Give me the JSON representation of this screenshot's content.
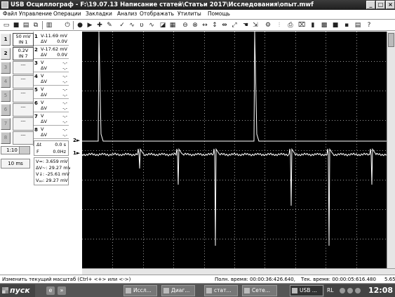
{
  "window": {
    "title": "USB Осциллограф - F:\\19.07.13 Написание статей\\Статьи 2017\\Исследования\\опыт.mwf",
    "minimize": "_",
    "maximize": "□",
    "close": "×"
  },
  "menu": [
    "Файл",
    "Управление",
    "Операции",
    "Закладки",
    "Анализ",
    "Отображать",
    "Утилиты",
    "Помощь"
  ],
  "channels": [
    {
      "range": "50 mV",
      "input": "IN 1"
    },
    {
      "range": "0.2V",
      "input": "IN 7"
    },
    {
      "range": "---",
      "input": ""
    },
    {
      "range": "---",
      "input": ""
    },
    {
      "range": "---",
      "input": ""
    },
    {
      "range": "---",
      "input": ""
    },
    {
      "range": "---",
      "input": ""
    },
    {
      "range": "---",
      "input": ""
    }
  ],
  "left_buttons": [
    "1",
    "2",
    "3",
    "4",
    "5",
    "6",
    "7",
    "8"
  ],
  "measurements": [
    {
      "num": "1",
      "l1": "V",
      "l2": "ΔV",
      "v1": "-11.69 mV",
      "v2": "0.0V"
    },
    {
      "num": "2",
      "l1": "V",
      "l2": "ΔV",
      "v1": "-17.62 mV",
      "v2": "0.0V"
    },
    {
      "num": "3",
      "l1": "V",
      "l2": "ΔV",
      "v1": "-,-",
      "v2": "-,-"
    },
    {
      "num": "4",
      "l1": "V",
      "l2": "ΔV",
      "v1": "-,-",
      "v2": "-,-"
    },
    {
      "num": "5",
      "l1": "V",
      "l2": "ΔV",
      "v1": "-,-",
      "v2": "-,-"
    },
    {
      "num": "6",
      "l1": "V",
      "l2": "ΔV",
      "v1": "-,-",
      "v2": "-,-"
    },
    {
      "num": "7",
      "l1": "V",
      "l2": "ΔV",
      "v1": "-,-",
      "v2": "-,-"
    },
    {
      "num": "8",
      "l1": "V",
      "l2": "ΔV",
      "v1": "-,-",
      "v2": "-,-"
    }
  ],
  "time_meas": {
    "t_label": "Δt",
    "t_value": "0.0 s",
    "f_label": "F",
    "f_value": "0.0Hz"
  },
  "scale": "1:10",
  "timebase": "10 ms",
  "vstats": [
    "V=: 3.659 mV",
    "ΔV~: 29.27 mV",
    "V↓: -25.61 mV",
    "Vₚₚ: 29.27 mV"
  ],
  "channel_markers": [
    "2",
    "1"
  ],
  "status": {
    "hint": "Изменить текущий масштаб (Ctrl+ <+> или <->)",
    "full_time": "Полн. время: 00:00:36:426.640,",
    "cur_time": "Тек. время: 00:00:05:616.480",
    "extra": "5.65"
  },
  "taskbar": {
    "start": "пуск",
    "tasks": [
      "Иссл...",
      "Диаг...",
      "стат...",
      "Сете...",
      "USB ..."
    ],
    "lang": "RL",
    "clock": "12:08"
  },
  "colors": {
    "scope_bg": "#000000",
    "trace": "#ffffff",
    "grid": "#9a9a9a"
  }
}
